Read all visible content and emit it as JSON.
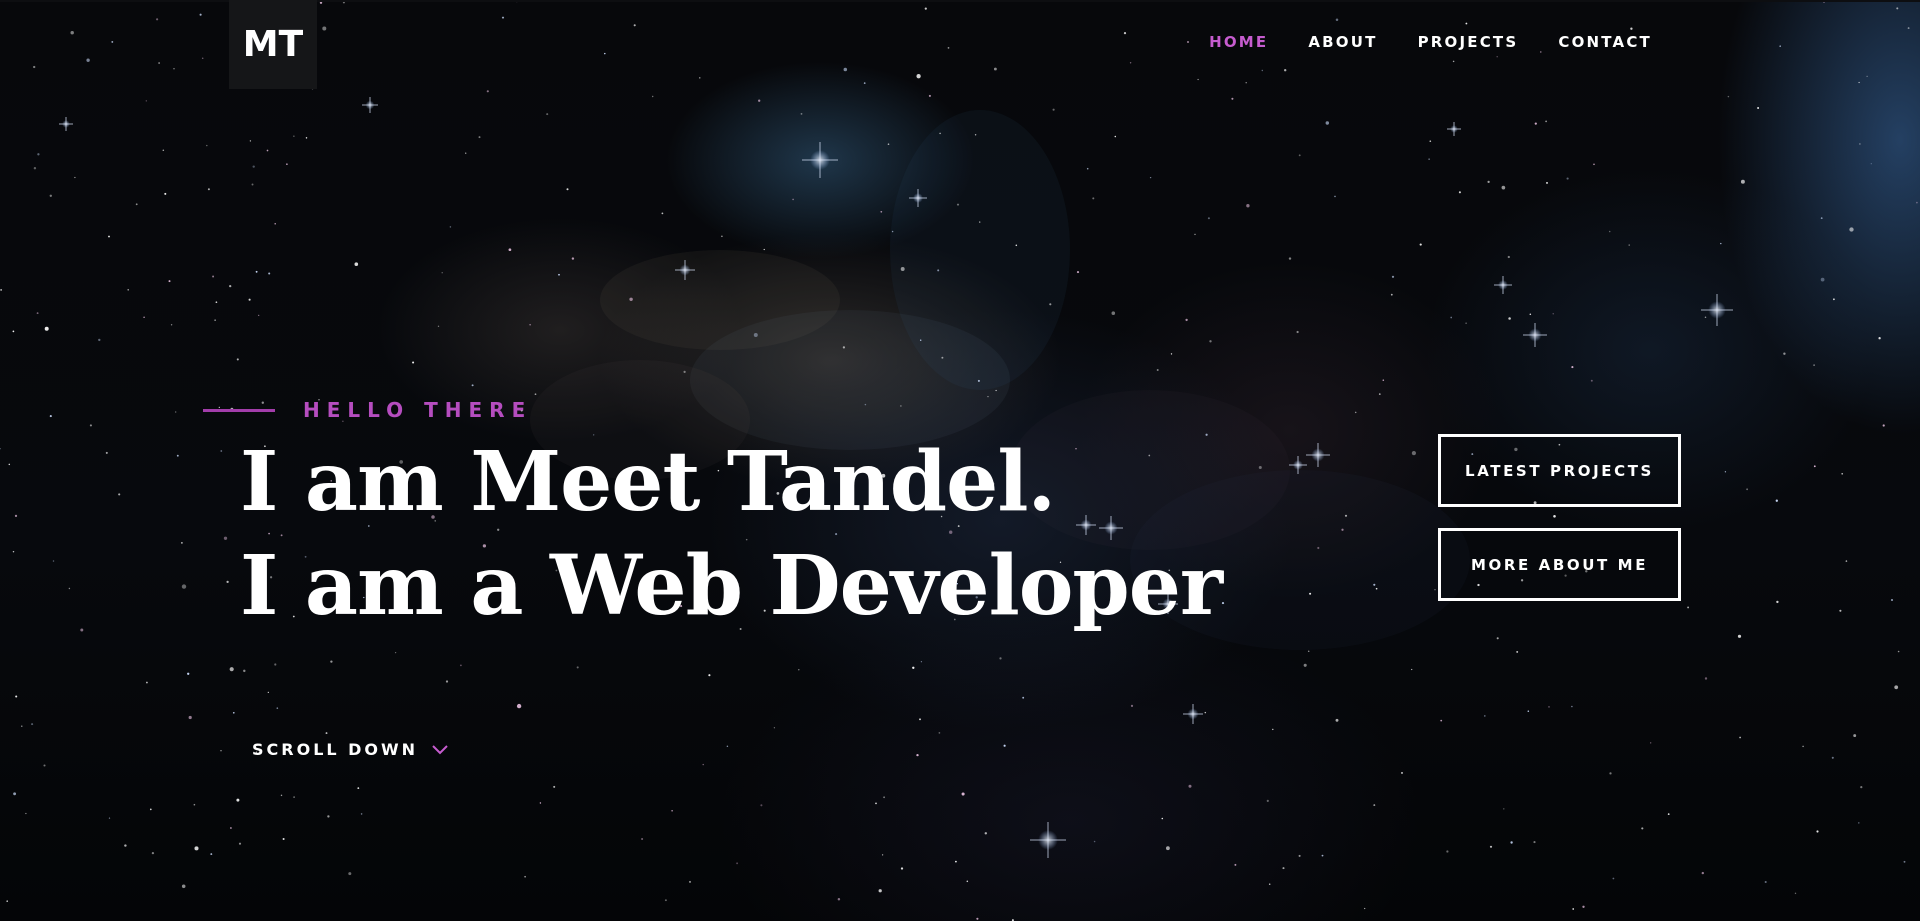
{
  "logo": {
    "text": "MT"
  },
  "nav": {
    "items": [
      {
        "label": "HOME",
        "active": true
      },
      {
        "label": "ABOUT",
        "active": false
      },
      {
        "label": "PROJECTS",
        "active": false
      },
      {
        "label": "CONTACT",
        "active": false
      }
    ]
  },
  "hero": {
    "intro": "HELLO THERE",
    "line1": "I am Meet Tandel.",
    "line2": "I am a Web Developer"
  },
  "cta": {
    "primary": "LATEST PROJECTS",
    "secondary": "MORE ABOUT ME"
  },
  "scroll": {
    "label": "SCROLL DOWN",
    "icon": "chevron-down-icon"
  },
  "colors": {
    "accent": "#c65ccf",
    "accent_line": "#a23daa",
    "text": "#ffffff",
    "background": "#07080b"
  }
}
